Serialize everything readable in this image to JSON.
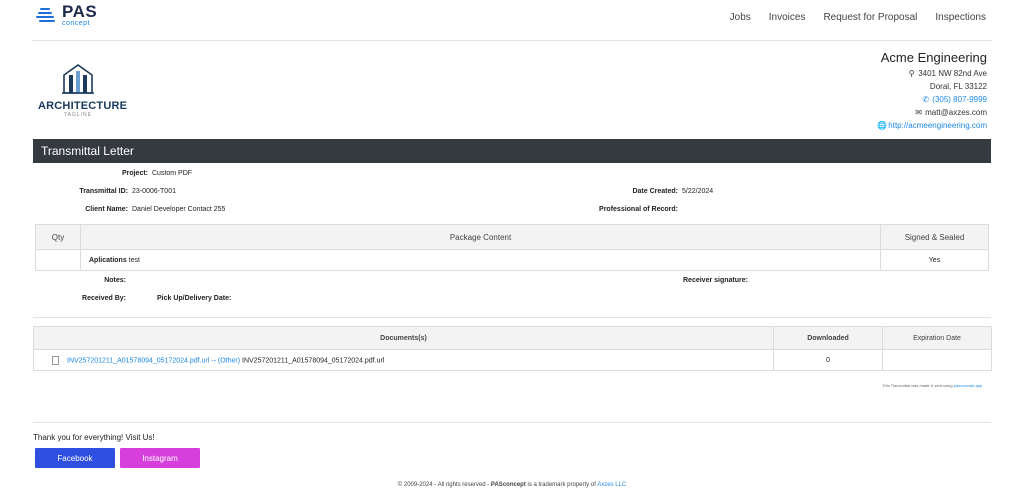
{
  "header": {
    "logo_text": "PAS",
    "logo_sub": "concept",
    "nav": [
      "Jobs",
      "Invoices",
      "Request for Proposal",
      "Inspections"
    ]
  },
  "company": {
    "logo_word": "ARCHITECTURE",
    "logo_tagline": "TAGLINE",
    "name": "Acme Engineering",
    "address_line1": "3401 NW 82nd Ave",
    "address_line2": "Doral, FL 33122",
    "phone": "(305) 807-9999",
    "email": "matt@axzes.com",
    "website": "http://acmeengineering.com"
  },
  "transmittal": {
    "title": "Transmittal Letter",
    "project_label": "Project:",
    "project": "Custom PDF",
    "id_label": "Transmittal ID:",
    "id": "23-0006-T001",
    "client_label": "Client Name:",
    "client": "Daniel Developer Contact 255",
    "date_label": "Date Created:",
    "date": "5/22/2024",
    "professional_label": "Professional of Record:",
    "professional": ""
  },
  "package": {
    "headers": [
      "Qty",
      "Package Content",
      "Signed & Sealed"
    ],
    "row": {
      "qty": "",
      "content_bold": "Aplications",
      "content_rest": " test",
      "signed": "Yes"
    }
  },
  "notes": {
    "notes_label": "Notes:",
    "receiver_label": "Receiver signature:",
    "received_label": "Received By:",
    "pickup_label": "Pick Up/Delivery Date:"
  },
  "documents": {
    "headers": [
      "Documents(s)",
      "Downloaded",
      "Expiration Date"
    ],
    "row": {
      "link": "INV257201211_A01578094_05172024.pdf.url -- (Other)",
      "filename": " INV257201211_A01578094_05172024.pdf.url",
      "downloaded": "0",
      "expiration": ""
    }
  },
  "note_small": {
    "text": "This Transmittal was made & sent using ",
    "link": "pasconcept app"
  },
  "footer": {
    "thanks": "Thank you for everything! Visit Us!",
    "facebook": "Facebook",
    "instagram": "Instagram",
    "copyright": "© 2009-2024 - All rights reserved - ",
    "brand": "PASconcept",
    "trademark": " is a trademark property of ",
    "company_link": "Axzes LLC",
    "colors": {
      "facebook": "#2f4fe0",
      "instagram": "#d63fdc",
      "header_bar": "#343a40",
      "link": "#1e88e5"
    }
  }
}
